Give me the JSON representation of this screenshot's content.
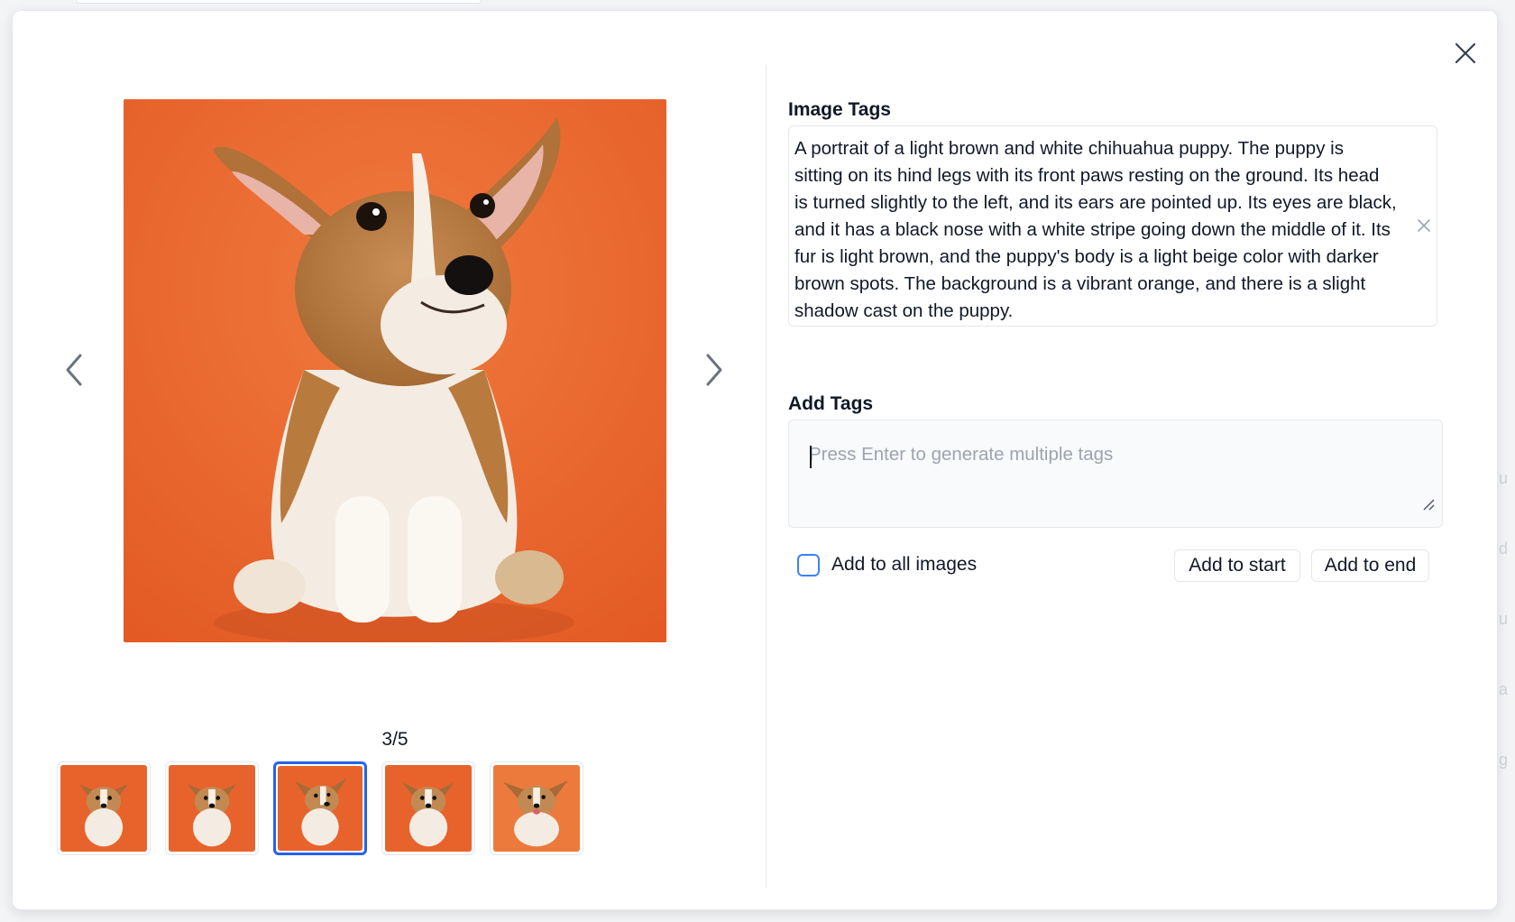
{
  "dialog": {
    "close_icon": "close-icon"
  },
  "gallery": {
    "counter": "3/5",
    "current_index": 3,
    "total": 5,
    "prev_icon": "chevron-left-icon",
    "next_icon": "chevron-right-icon",
    "thumbnails": [
      {
        "index": 1,
        "active": false
      },
      {
        "index": 2,
        "active": false
      },
      {
        "index": 3,
        "active": true
      },
      {
        "index": 4,
        "active": false
      },
      {
        "index": 5,
        "active": false
      }
    ]
  },
  "image_tags": {
    "title": "Image Tags",
    "tags": [
      {
        "text": "A portrait of a light brown and white chihuahua puppy. The puppy is sitting on its hind legs with its front paws resting on the ground. Its head is turned slightly to the left, and its ears are pointed up. Its eyes are black, and it has a black nose with a white stripe going down the middle of it. Its fur is light brown, and the puppy's body is a light beige color with darker brown spots. The background is a vibrant orange, and there is a slight shadow cast on the puppy.",
        "remove_icon": "x-icon"
      }
    ]
  },
  "add_tags": {
    "title": "Add Tags",
    "value": "",
    "placeholder": "Press Enter to generate multiple tags",
    "add_to_all_label": "Add to all images",
    "add_to_all_checked": false,
    "add_to_start_label": "Add to start",
    "add_to_end_label": "Add to end"
  },
  "colors": {
    "accent": "#2563eb",
    "image_background": "#e8632b",
    "border": "#e5e7eb"
  }
}
